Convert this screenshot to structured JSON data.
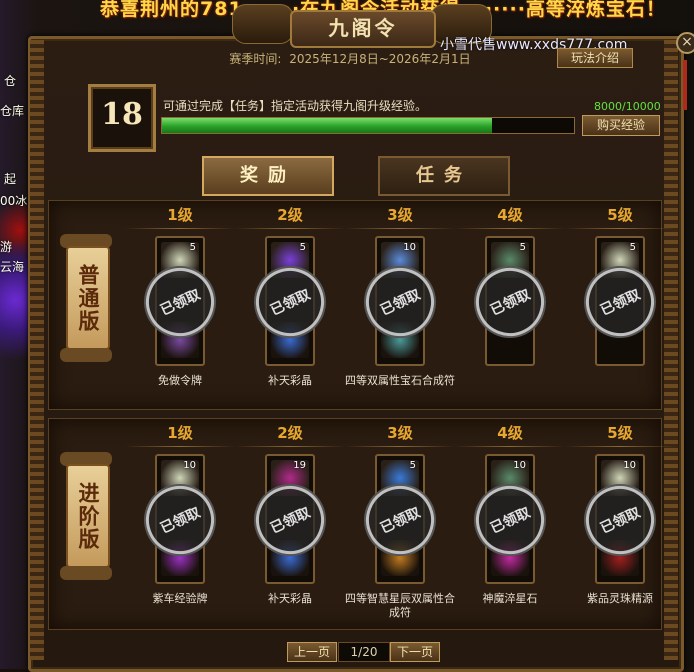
{
  "background": {
    "banner": "恭喜荆州的781·······在九阁令活动获得········高等淬炼宝石！",
    "banner_sub": "荆州的",
    "left_labels": [
      "仓",
      "仓库",
      "起",
      "00冰",
      "游",
      "云海"
    ]
  },
  "window": {
    "title": "九阁令",
    "watermark": "小雪代售www.xxds777.com",
    "close_glyph": "×"
  },
  "season": {
    "label": "赛季时间:",
    "range": "2025年12月8日~2026年2月1日"
  },
  "rules_button": "玩法介绍",
  "progress": {
    "level": "18",
    "description": "可通过完成【任务】指定活动获得九阁升级经验。",
    "current": 8000,
    "max": 10000,
    "count_text": "8000/10000",
    "buy_button": "购买经验"
  },
  "tabs": [
    {
      "label": "奖励",
      "active": true
    },
    {
      "label": "任务",
      "active": false
    }
  ],
  "level_headers": [
    "1级",
    "2级",
    "3级",
    "4级",
    "5级"
  ],
  "tracks": [
    {
      "label": "普通版",
      "rewards": [
        {
          "qty": "5",
          "name": "免做令牌",
          "icon": "scroll-icon",
          "color": "#cfd6b8",
          "stamp": "已领取",
          "bottom_color": "#7a4aa0"
        },
        {
          "qty": "5",
          "name": "补天彩晶",
          "icon": "crystal-icon",
          "color": "#7a40d8",
          "stamp": "已领取",
          "bottom_color": "#3a6ad0"
        },
        {
          "qty": "10",
          "name": "四等双属性宝石合成符",
          "icon": "gem-icon",
          "color": "#5a8ad8",
          "stamp": "已领取",
          "bottom_color": "#4a9a9a"
        },
        {
          "qty": "5",
          "name": "",
          "icon": "token-icon",
          "color": "#5a8a6a",
          "stamp": "已领取",
          "bottom_color": ""
        },
        {
          "qty": "5",
          "name": "",
          "icon": "scroll-icon",
          "color": "#cfd6b8",
          "stamp": "已领取",
          "bottom_color": ""
        }
      ]
    },
    {
      "label": "进阶版",
      "rewards": [
        {
          "qty": "10",
          "name": "紫车经验牌",
          "icon": "scroll-icon",
          "color": "#cfd6b8",
          "stamp": "已领取",
          "bottom_color": "#9a30c0"
        },
        {
          "qty": "19",
          "name": "补天彩晶",
          "icon": "crystal-icon",
          "color": "#b02a8a",
          "stamp": "已领取",
          "bottom_color": "#3a6ad0"
        },
        {
          "qty": "5",
          "name": "四等智慧星辰双属性合成符",
          "icon": "gem-icon",
          "color": "#3a7ad8",
          "stamp": "已领取",
          "bottom_color": "#c07a20"
        },
        {
          "qty": "10",
          "name": "神魔淬星石",
          "icon": "token-icon",
          "color": "#5a8a6a",
          "stamp": "已领取",
          "bottom_color": "#c02aa0"
        },
        {
          "qty": "10",
          "name": "紫品灵珠精源",
          "icon": "scroll-icon",
          "color": "#cfd6b8",
          "stamp": "已领取",
          "bottom_color": "#a02020"
        }
      ]
    }
  ],
  "pager": {
    "prev": "上一页",
    "page": "1/20",
    "next": "下一页"
  }
}
